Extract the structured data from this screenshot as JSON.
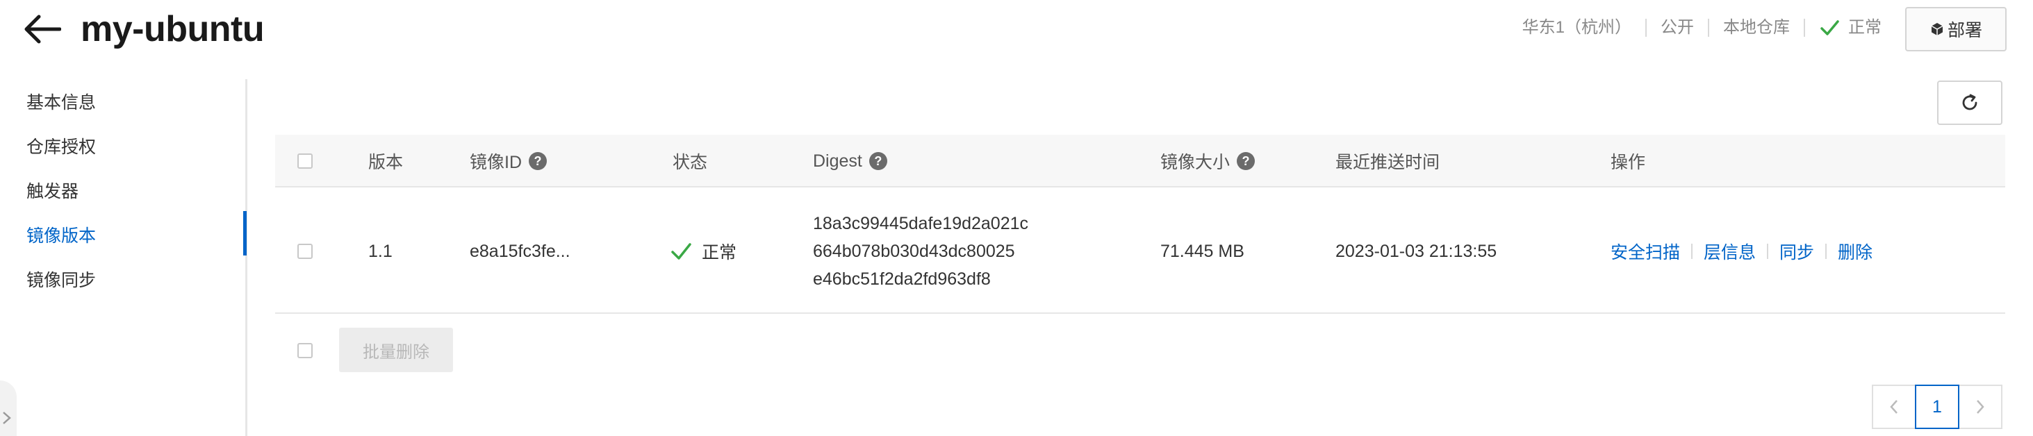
{
  "header": {
    "title": "my-ubuntu",
    "region": "华东1（杭州）",
    "visibility": "公开",
    "repo_type": "本地仓库",
    "status": "正常",
    "deploy_label": "部署"
  },
  "sidebar": {
    "items": [
      {
        "label": "基本信息"
      },
      {
        "label": "仓库授权"
      },
      {
        "label": "触发器"
      },
      {
        "label": "镜像版本"
      },
      {
        "label": "镜像同步"
      }
    ],
    "active": "镜像版本"
  },
  "table": {
    "columns": {
      "version": "版本",
      "image_id": "镜像ID",
      "status": "状态",
      "digest": "Digest",
      "size": "镜像大小",
      "pushed": "最近推送时间",
      "ops": "操作"
    },
    "rows": [
      {
        "version": "1.1",
        "image_id": "e8a15fc3fe...",
        "status": "正常",
        "digest_lines": [
          "18a3c99445dafe19d2a021c",
          "664b078b030d43dc80025",
          "e46bc51f2da2fd963df8"
        ],
        "size": "71.445 MB",
        "pushed": "2023-01-03 21:13:55",
        "actions": [
          "安全扫描",
          "层信息",
          "同步",
          "删除"
        ]
      }
    ]
  },
  "batch_delete_label": "批量删除",
  "pagination": {
    "current": "1"
  },
  "colors": {
    "accent": "#0064c8",
    "success": "#3aa845"
  }
}
